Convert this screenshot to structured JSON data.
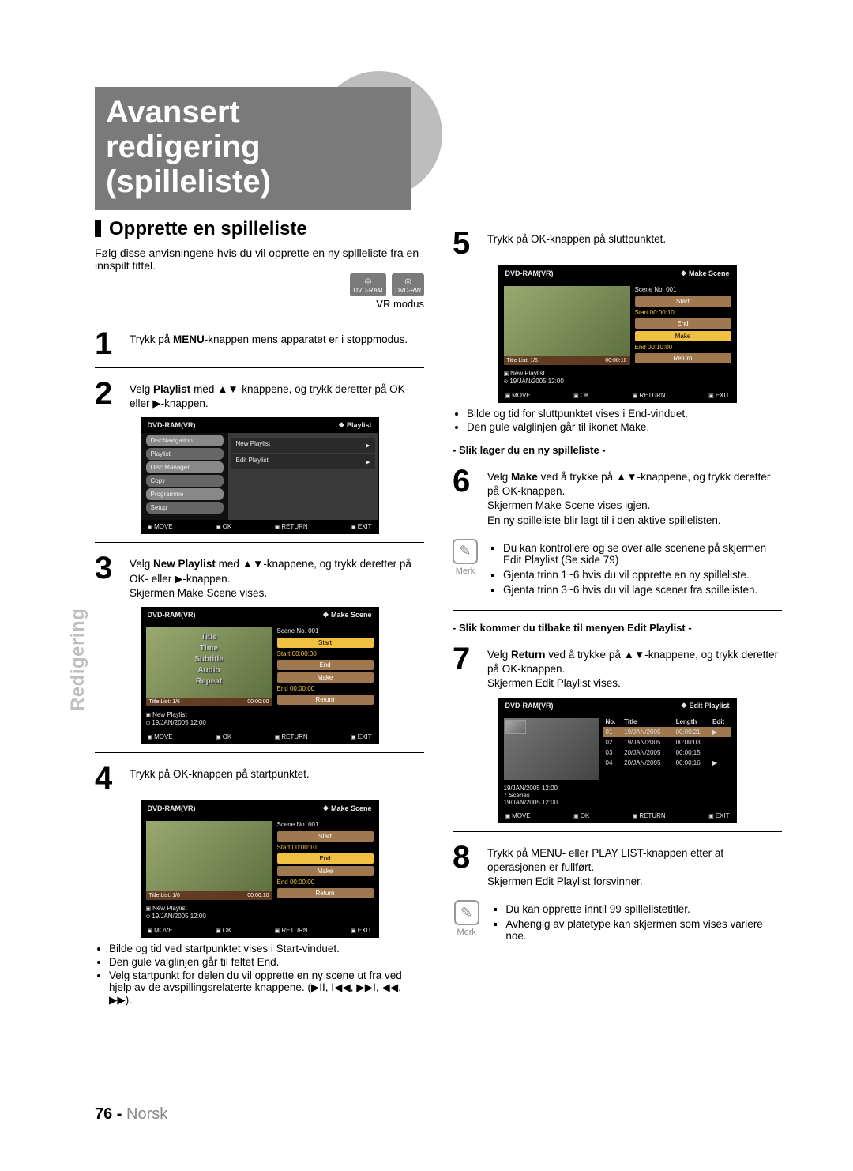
{
  "page": {
    "number": "76 -",
    "language": "Norsk",
    "side_tab": "Redigering"
  },
  "hero": {
    "line1": "Avansert redigering",
    "line2": "(spilleliste)"
  },
  "section1": {
    "title": "Opprette en spilleliste",
    "lead": "Følg disse anvisningene hvis du vil opprette en ny spilleliste fra en innspilt tittel.",
    "disc_icons": [
      "DVD-RAM",
      "DVD-RW"
    ],
    "vrmode": "VR modus"
  },
  "step1": {
    "num": "1",
    "text_before": "Trykk på ",
    "bold": "MENU",
    "text_after": "-knappen mens apparatet er i stoppmodus."
  },
  "step2": {
    "num": "2",
    "text_before": "Velg ",
    "bold": "Playlist",
    "text_after": " med ▲▼-knappene, og trykk deretter på OK- eller ▶-knappen."
  },
  "osd_menu": {
    "header_left": "DVD-RAM(VR)",
    "header_right": "Playlist",
    "left_items": [
      "DiscNavigation",
      "Playlist",
      "Disc Manager",
      "Copy",
      "Programme",
      "Setup"
    ],
    "right_items": [
      "New Playlist",
      "Edit Playlist"
    ],
    "footer": [
      "MOVE",
      "OK",
      "RETURN",
      "EXIT"
    ]
  },
  "step3": {
    "num": "3",
    "line1_before": "Velg ",
    "line1_bold": "New Playlist",
    "line1_after": " med ▲▼-knappene, og trykk deretter på OK- eller ▶-knappen.",
    "line2": "Skjermen Make Scene vises."
  },
  "osd_scene_common": {
    "header_left": "DVD-RAM(VR)",
    "header_right": "Make Scene",
    "ghost": [
      "Title",
      "Time",
      "Subtitle",
      "Audio",
      "Repeat"
    ],
    "title_list": "Title List: 1/6",
    "scene_no": "Scene No. 001",
    "buttons": [
      "Start",
      "End",
      "Make",
      "Return"
    ],
    "info_new": "New Playlist",
    "info_date": "19/JAN/2005 12:00",
    "footer": [
      "MOVE",
      "OK",
      "RETURN",
      "EXIT"
    ]
  },
  "osd_scene3": {
    "play_time": "00:00:00",
    "start": "Start   00:00:00",
    "end": "End     00:00:00",
    "hl": "Start"
  },
  "step4": {
    "num": "4",
    "text": "Trykk på OK-knappen på startpunktet."
  },
  "osd_scene4": {
    "play_time": "00:00:10",
    "start": "Start   00:00:10",
    "end": "End     00:00:00",
    "hl": "End"
  },
  "bullets4": [
    "Bilde og tid ved startpunktet vises i Start-vinduet.",
    "Den gule valglinjen går til feltet End.",
    "Velg startpunkt for delen du vil opprette en ny scene ut fra ved hjelp av de avspillingsrelaterte knappene. (▶II, I◀◀, ▶▶I, ◀◀, ▶▶)."
  ],
  "step5": {
    "num": "5",
    "text": "Trykk på OK-knappen på sluttpunktet."
  },
  "osd_scene5": {
    "play_time": "00:00:10",
    "start": "Start   00:00:10",
    "end": "End     00:10:00",
    "hl": "Make"
  },
  "bullets5": [
    "Bilde og tid for sluttpunktet vises i End-vinduet.",
    "Den gule valglinjen går til ikonet Make."
  ],
  "subhead6": "- Slik lager du en ny spilleliste -",
  "step6": {
    "num": "6",
    "line1_before": "Velg ",
    "line1_bold": "Make",
    "line1_after": " ved å trykke på ▲▼-knappene, og trykk deretter på OK-knappen.",
    "line2": "Skjermen Make Scene vises igjen.",
    "line3": "En ny spilleliste blir lagt til i den aktive spillelisten."
  },
  "note1": {
    "label": "Merk",
    "items": [
      "Du kan kontrollere og se over alle scenene på skjermen Edit Playlist (Se side 79)",
      "Gjenta trinn 1~6 hvis du vil opprette en ny spilleliste.",
      "Gjenta trinn 3~6 hvis du vil lage scener fra spillelisten."
    ]
  },
  "subhead7": "- Slik kommer du tilbake til menyen Edit Playlist -",
  "step7": {
    "num": "7",
    "line1_before": "Velg ",
    "line1_bold": "Return",
    "line1_after": " ved å trykke på ▲▼-knappene, og trykk deretter på OK-knappen.",
    "line2": "Skjermen Edit Playlist vises."
  },
  "osd_edit": {
    "header_left": "DVD-RAM(VR)",
    "header_right": "Edit Playlist",
    "cols": [
      "No.",
      "Title",
      "Length",
      "Edit"
    ],
    "rows": [
      [
        "01",
        "19/JAN/2005",
        "00:00:21",
        "▶"
      ],
      [
        "02",
        "19/JAN/2005",
        "00:00:03",
        ""
      ],
      [
        "03",
        "20/JAN/2005",
        "00:00:15",
        ""
      ],
      [
        "04",
        "20/JAN/2005",
        "00:00:16",
        "▶"
      ]
    ],
    "info_date": "19/JAN/2005 12:00",
    "info_scenes": "7 Scenes",
    "info_date2": "19/JAN/2005 12:00",
    "footer": [
      "MOVE",
      "OK",
      "RETURN",
      "EXIT"
    ]
  },
  "step8": {
    "num": "8",
    "line1": "Trykk på MENU- eller PLAY LIST-knappen etter at operasjonen er fullført.",
    "line2": "Skjermen Edit Playlist forsvinner."
  },
  "note2": {
    "label": "Merk",
    "items": [
      "Du kan opprette inntil 99 spillelistetitler.",
      "Avhengig av platetype kan skjermen som vises variere noe."
    ]
  }
}
